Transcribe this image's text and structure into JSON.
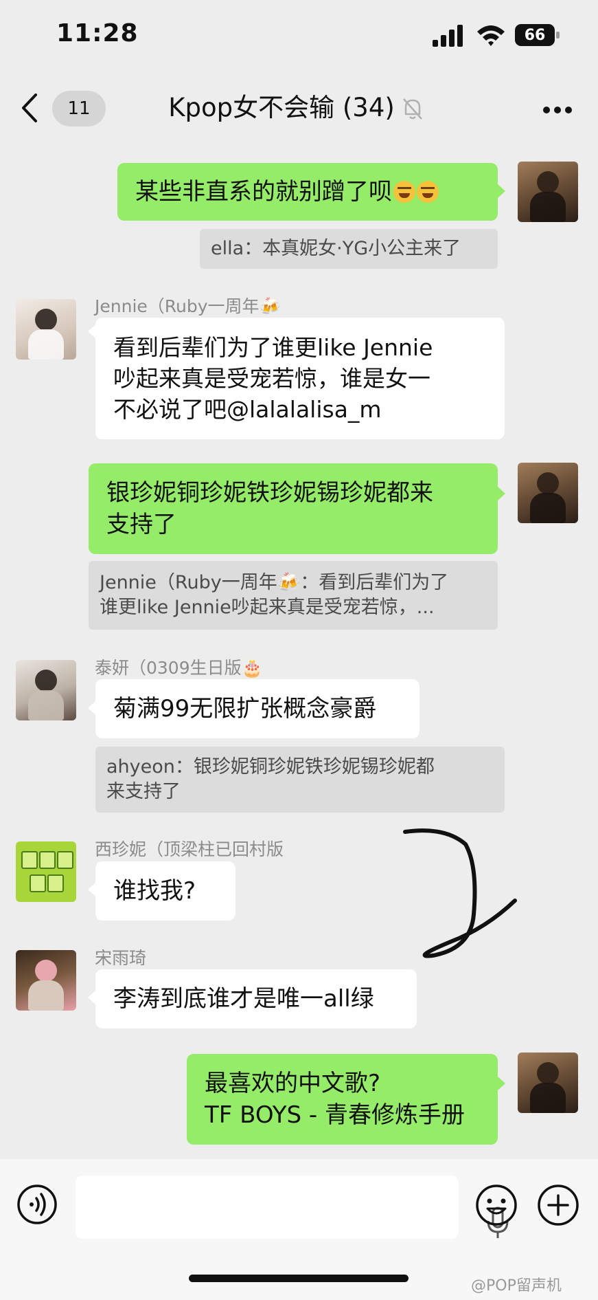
{
  "status_bar": {
    "time": "11:28",
    "battery": "66"
  },
  "header": {
    "unread_count": "11",
    "title": "Kpop女不会输 (34)"
  },
  "messages": {
    "m1": {
      "text": "某些非直系的就别蹭了呗"
    },
    "q1": {
      "text": "ella：本真妮女·YG小公主来了"
    },
    "m2": {
      "sender": "Jennie（Ruby一周年🍻",
      "lines": [
        "看到后辈们为了谁更like Jennie",
        "吵起来真是受宠若惊，谁是女一",
        "不必说了吧@lalalalisa_m"
      ]
    },
    "m3": {
      "lines": [
        "银珍妮铜珍妮铁珍妮锡珍妮都来",
        "支持了"
      ]
    },
    "q3": {
      "lines": [
        "Jennie（Ruby一周年🍻：看到后辈们为了",
        "谁更like Jennie吵起来真是受宠若惊，..."
      ]
    },
    "m4": {
      "sender": "泰妍（0309生日版🎂",
      "text": "菊满99无限扩张概念豪爵"
    },
    "q4": {
      "lines": [
        "ahyeon：银珍妮铜珍妮铁珍妮锡珍妮都",
        "来支持了"
      ]
    },
    "m5": {
      "sender": "西珍妮（顶梁柱已回村版",
      "text": "谁找我?"
    },
    "m6": {
      "sender": "宋雨琦",
      "text": "李涛到底谁才是唯一all绿"
    },
    "m7": {
      "lines": [
        "最喜欢的中文歌?",
        "TF BOYS - 青春修炼手册"
      ]
    }
  },
  "footer": {
    "watermark": "@POP留声机"
  },
  "colors": {
    "background": "#ededed",
    "outgoing_bubble": "#95ec69",
    "incoming_bubble": "#ffffff",
    "quote_box": "#dcdcdc"
  },
  "icons": [
    "back-chevron-icon",
    "mute-bell-icon",
    "more-dots-icon",
    "voice-icon",
    "microphone-icon",
    "emoji-icon",
    "plus-icon",
    "laughing-emoji-icon"
  ]
}
